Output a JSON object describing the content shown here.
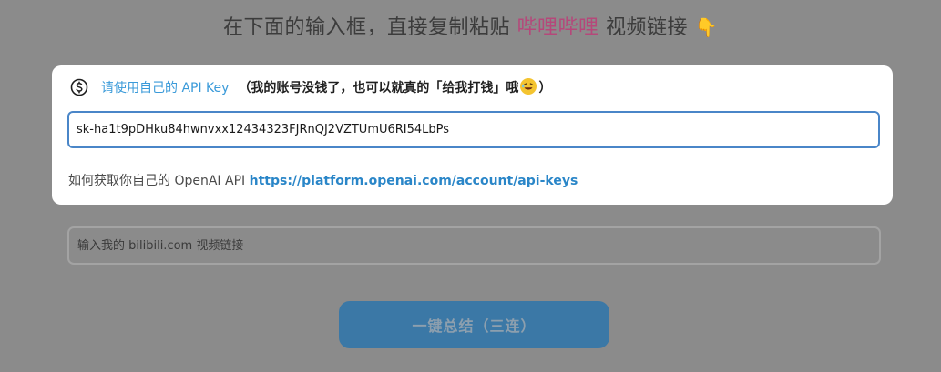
{
  "heading": {
    "prefix": "在下面的输入框，直接复制粘贴 ",
    "brand": "哔哩哔哩",
    "suffix": " 视频链接 ",
    "pointer_glyph": "👇",
    "brand_color": "#b5487a"
  },
  "api_card": {
    "icon": "dollar-circle-icon",
    "key_link_label": "请使用自己的 API Key",
    "note_before_emoji": "（我的账号没钱了，也可以就真的「给我打钱」哦",
    "emoji_icon": "rofl-face-icon",
    "note_after_emoji": "）",
    "key_value": "sk-ha1t9pDHku84hwnvxx12434323FJRnQJ2VZTUmU6RI54LbPs",
    "howto_text": "如何获取你自己的 OpenAI API ",
    "howto_url": "https://platform.openai.com/account/api-keys"
  },
  "video_input": {
    "placeholder": "输入我的 bilibili.com 视频链接",
    "value": ""
  },
  "summarize_button": {
    "label": "一键总结（三连）"
  },
  "colors": {
    "overlay": "#8b8b8b",
    "link": "#3a9ad9",
    "input_focus_border": "#4a86c8",
    "button": "#3b78a6"
  }
}
